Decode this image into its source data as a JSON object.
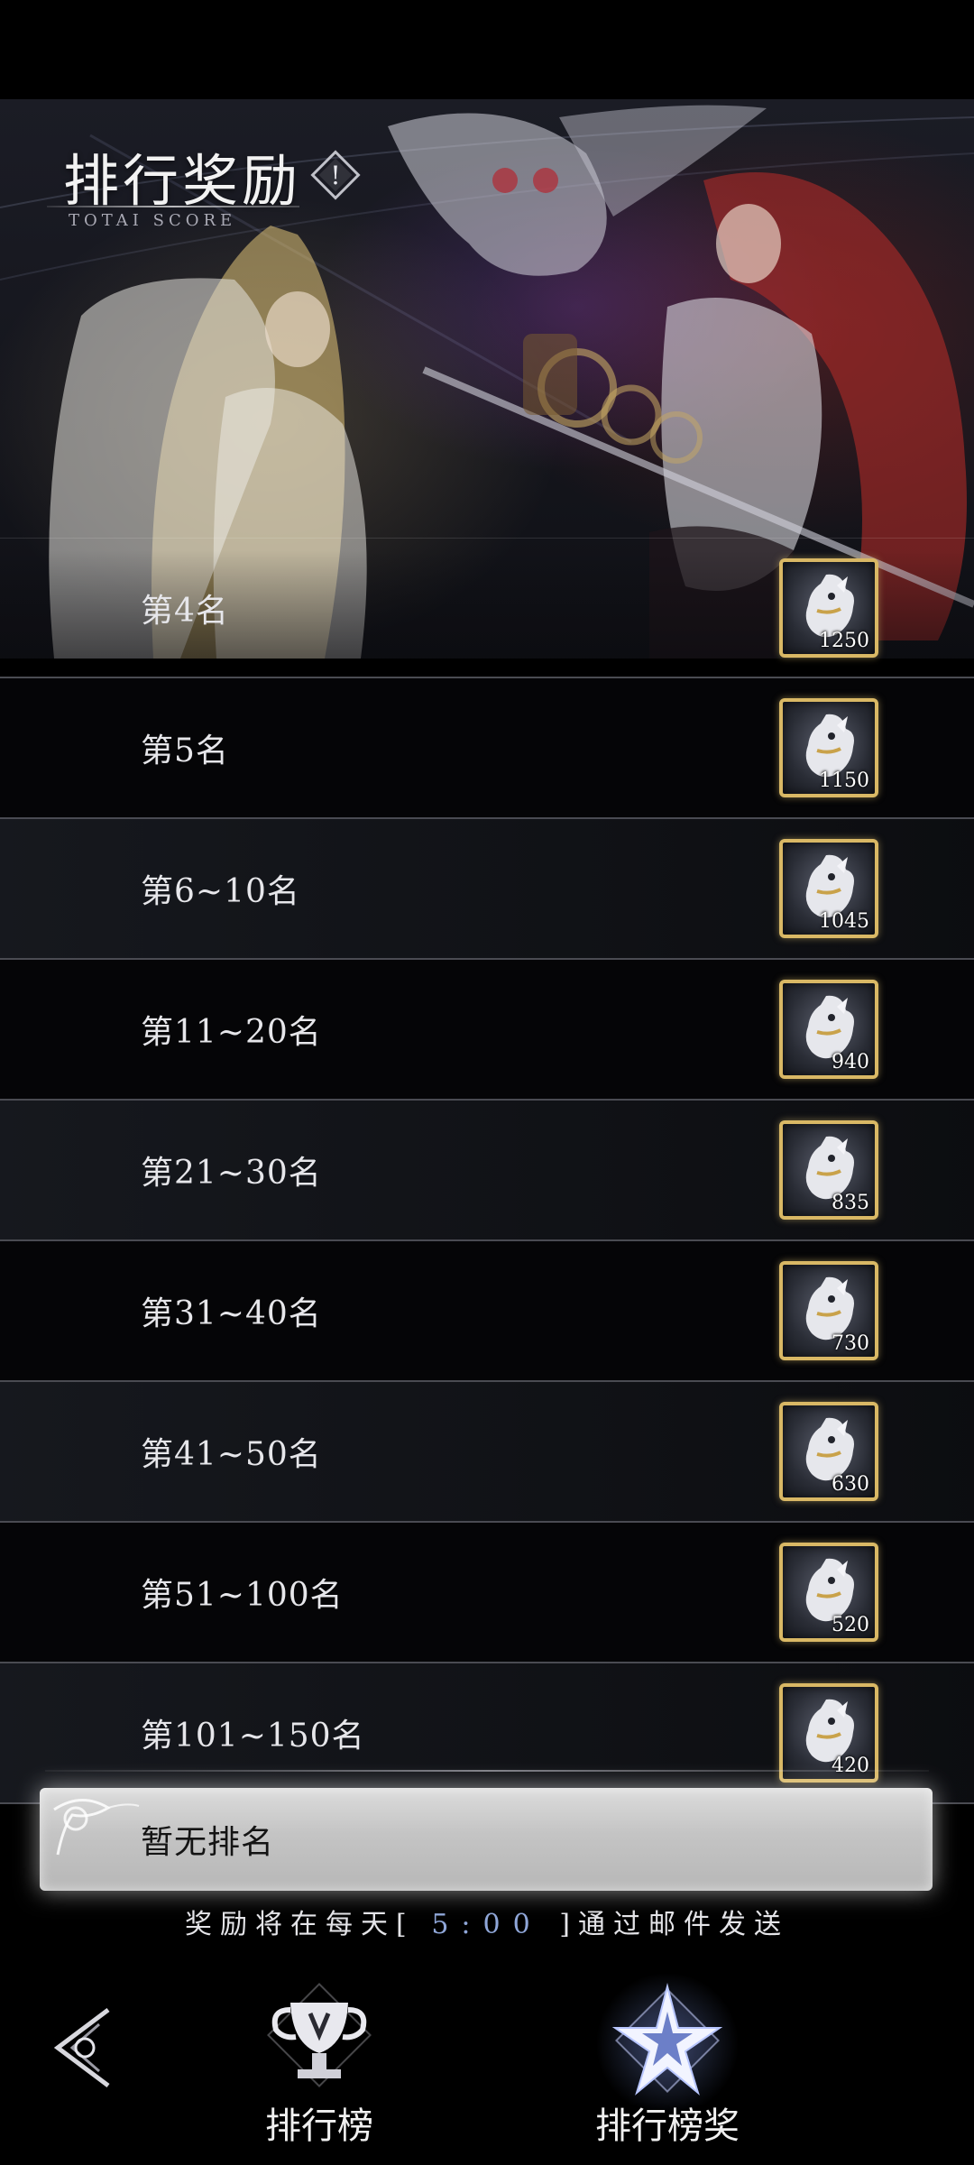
{
  "header": {
    "title": "排行奖励",
    "subtitle": "TOTAI SCORE"
  },
  "rewards": [
    {
      "label": "第4名",
      "count": "1250"
    },
    {
      "label": "第5名",
      "count": "1150"
    },
    {
      "label": "第6~10名",
      "count": "1045"
    },
    {
      "label": "第11~20名",
      "count": "940"
    },
    {
      "label": "第21~30名",
      "count": "835"
    },
    {
      "label": "第31~40名",
      "count": "730"
    },
    {
      "label": "第41~50名",
      "count": "630"
    },
    {
      "label": "第51~100名",
      "count": "520"
    },
    {
      "label": "第101~150名",
      "count": "420"
    }
  ],
  "current_rank": {
    "text": "暂无排名"
  },
  "notice": {
    "prefix": "奖励将在每天[",
    "time": "5:00",
    "suffix": "]通过邮件发送"
  },
  "nav": {
    "ranking_label": "排行榜",
    "rewards_label": "排行榜奖"
  },
  "colors": {
    "reward_border": "#d9b865",
    "notice_time": "#8fa6d8"
  }
}
